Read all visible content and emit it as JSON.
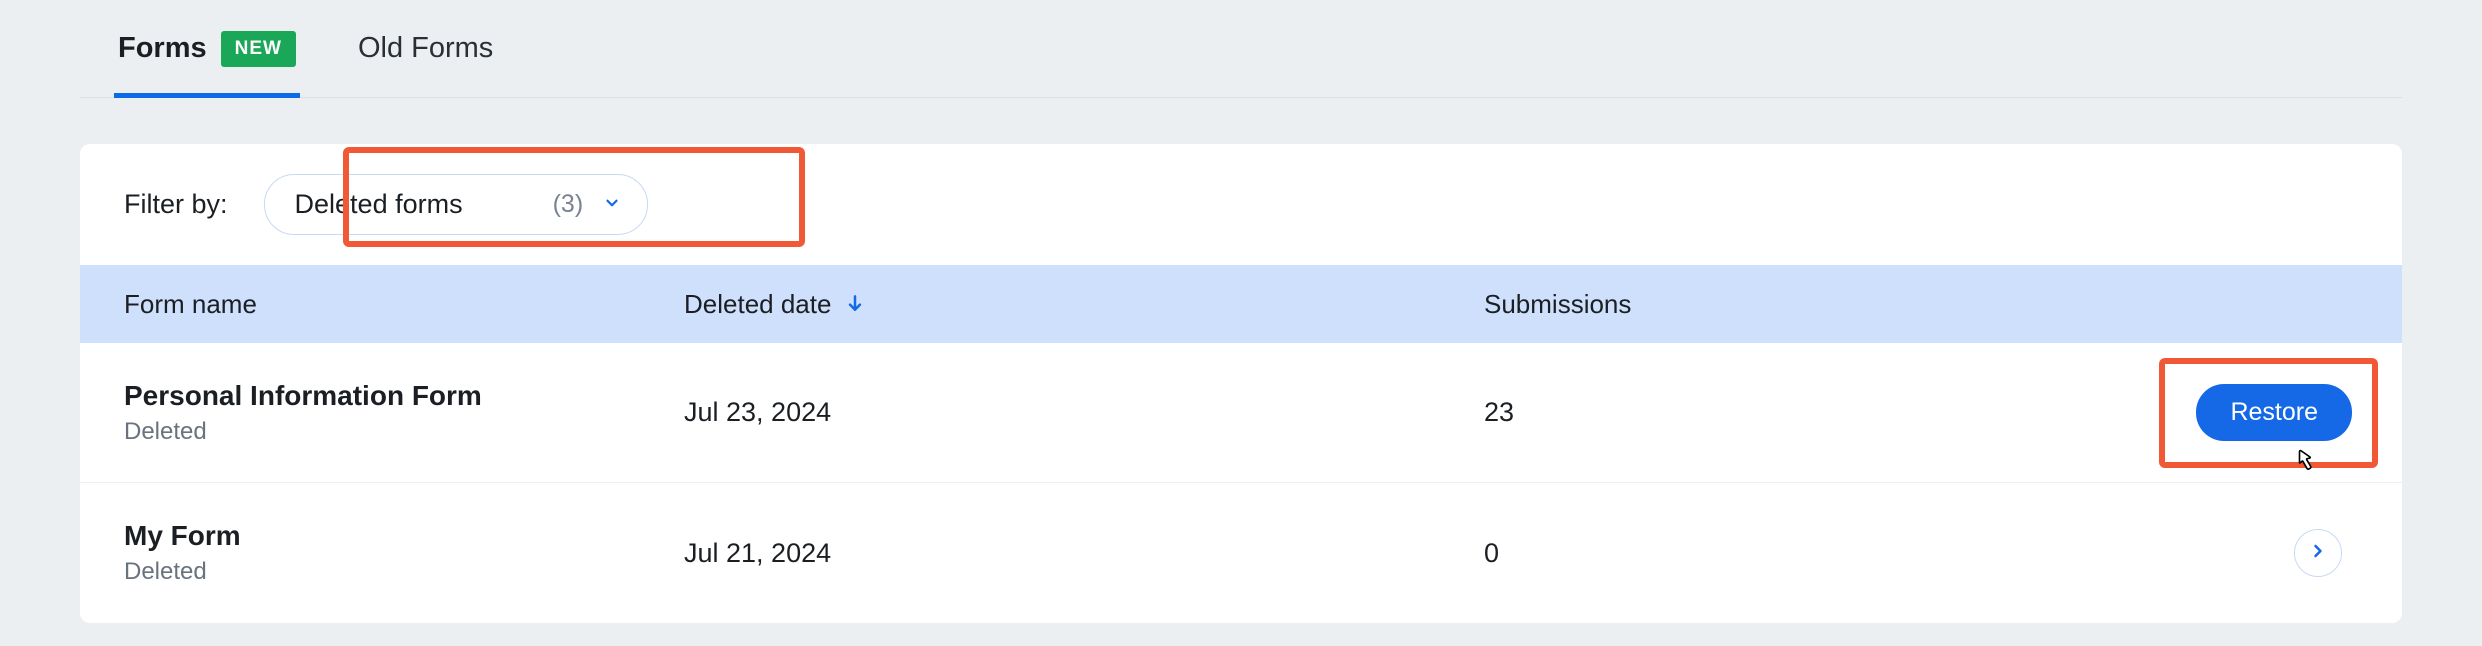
{
  "tabs": {
    "forms": {
      "label": "Forms",
      "badge": "NEW"
    },
    "old_forms": {
      "label": "Old Forms"
    }
  },
  "filter": {
    "label": "Filter by:",
    "selected": "Deleted forms",
    "count": "(3)"
  },
  "table": {
    "headers": {
      "name": "Form name",
      "deleted": "Deleted date",
      "subs": "Submissions"
    },
    "rows": [
      {
        "name": "Personal Information Form",
        "status": "Deleted",
        "deleted_date": "Jul 23, 2024",
        "submissions": "23",
        "action_label": "Restore",
        "highlighted": true
      },
      {
        "name": "My Form",
        "status": "Deleted",
        "deleted_date": "Jul 21, 2024",
        "submissions": "0",
        "action_label": "",
        "highlighted": false
      }
    ]
  },
  "colors": {
    "accent": "#1569e6",
    "badge_green": "#1aa758",
    "highlight_border": "#f05836",
    "header_bg": "#cfe0fc"
  }
}
